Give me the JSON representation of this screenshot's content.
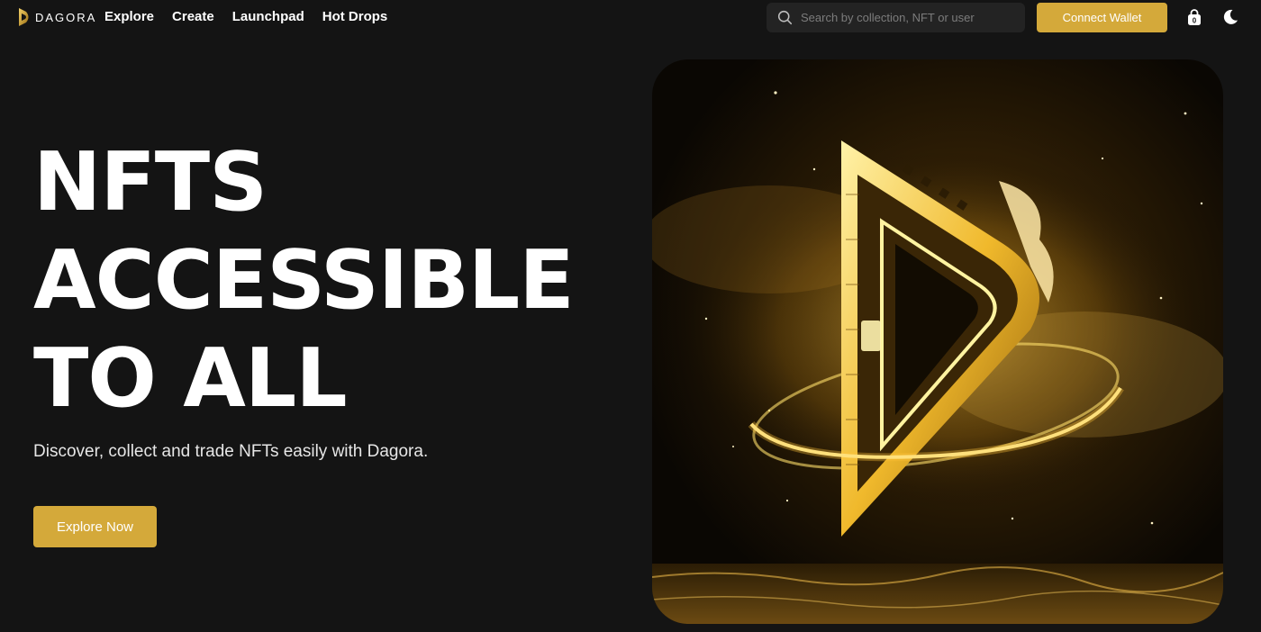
{
  "brand": {
    "name": "DAGORA"
  },
  "nav": {
    "links": [
      {
        "label": "Explore"
      },
      {
        "label": "Create"
      },
      {
        "label": "Launchpad"
      },
      {
        "label": "Hot Drops"
      }
    ]
  },
  "search": {
    "placeholder": "Search by collection, NFT or user",
    "icon": "search-icon"
  },
  "actions": {
    "connect_label": "Connect Wallet",
    "bag_icon": "bag-icon",
    "theme_icon": "moon-icon"
  },
  "hero": {
    "title_lines": [
      "NFTS",
      "ACCESSIBLE",
      "TO ALL"
    ],
    "subtitle": "Discover, collect and trade NFTs easily with Dagora.",
    "cta_label": "Explore Now"
  },
  "colors": {
    "accent": "#d4a93a",
    "background": "#141414",
    "search_bg": "#232323"
  }
}
